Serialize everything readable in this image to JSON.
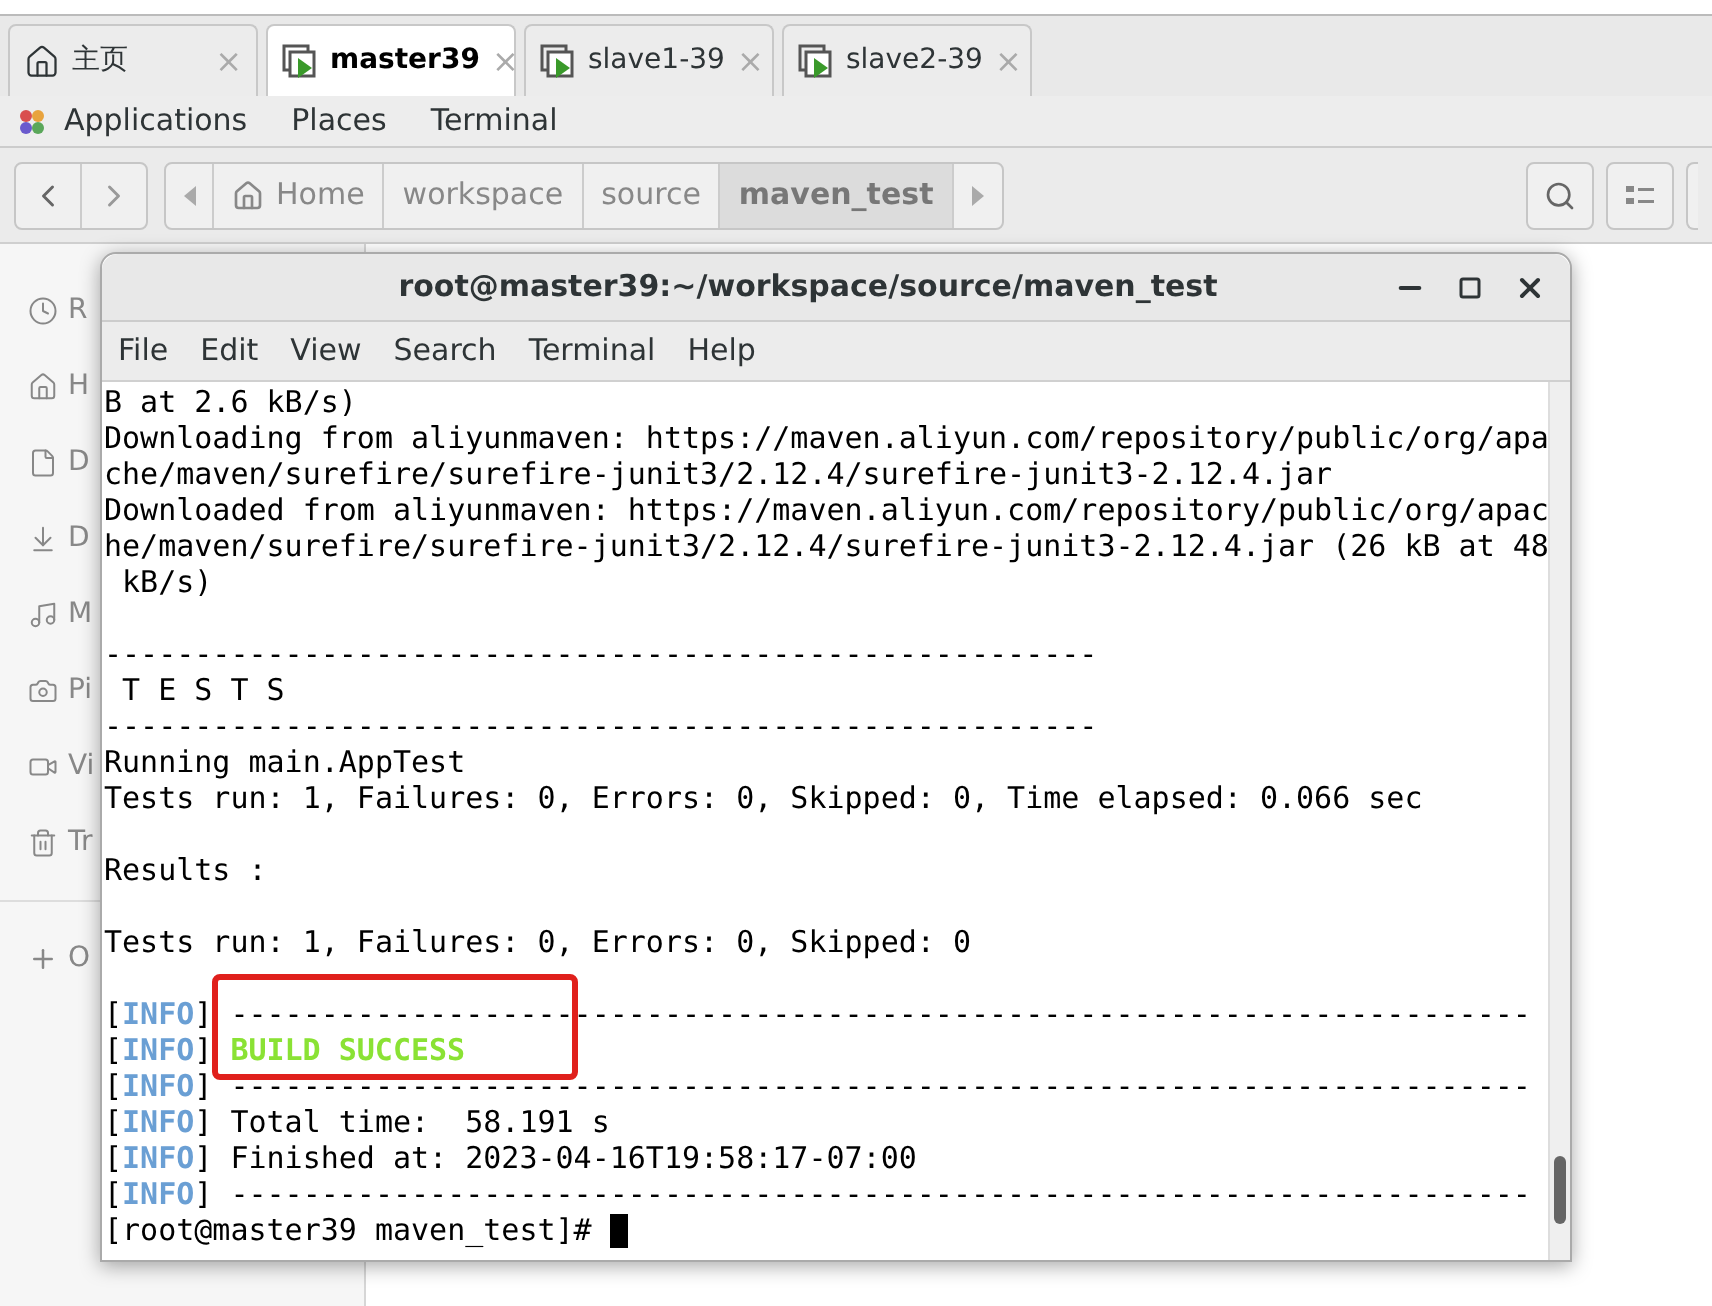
{
  "tabs": [
    {
      "label": "主页",
      "kind": "home",
      "close": "×",
      "selected": false
    },
    {
      "label": "master39",
      "kind": "session",
      "close": "×",
      "selected": true
    },
    {
      "label": "slave1-39",
      "kind": "session",
      "close": "×",
      "selected": false
    },
    {
      "label": "slave2-39",
      "kind": "session",
      "close": "×",
      "selected": false
    }
  ],
  "top_menu": [
    "Applications",
    "Places",
    "Terminal"
  ],
  "path_bar": [
    {
      "label": "Home",
      "kind": "home",
      "selected": false
    },
    {
      "label": "workspace",
      "kind": "folder",
      "selected": false
    },
    {
      "label": "source",
      "kind": "folder",
      "selected": false
    },
    {
      "label": "maven_test",
      "kind": "folder",
      "selected": true
    }
  ],
  "sidebar": {
    "items": [
      {
        "label": "R"
      },
      {
        "label": "H"
      },
      {
        "label": "D"
      },
      {
        "label": "D"
      },
      {
        "label": "M"
      },
      {
        "label": "Pi"
      },
      {
        "label": "Vi"
      },
      {
        "label": "Tr"
      }
    ],
    "other": {
      "label": "O"
    }
  },
  "terminal": {
    "title": "root@master39:~/workspace/source/maven_test",
    "menu": [
      "File",
      "Edit",
      "View",
      "Search",
      "Terminal",
      "Help"
    ],
    "lines": [
      {
        "kind": "plain",
        "text": "B at 2.6 kB/s)"
      },
      {
        "kind": "plain",
        "text": "Downloading from aliyunmaven: https://maven.aliyun.com/repository/public/org/apa"
      },
      {
        "kind": "plain",
        "text": "che/maven/surefire/surefire-junit3/2.12.4/surefire-junit3-2.12.4.jar"
      },
      {
        "kind": "plain",
        "text": "Downloaded from aliyunmaven: https://maven.aliyun.com/repository/public/org/apac"
      },
      {
        "kind": "plain",
        "text": "he/maven/surefire/surefire-junit3/2.12.4/surefire-junit3-2.12.4.jar (26 kB at 48"
      },
      {
        "kind": "plain",
        "text": " kB/s)"
      },
      {
        "kind": "blank"
      },
      {
        "kind": "plain",
        "text": "-------------------------------------------------------"
      },
      {
        "kind": "plain",
        "text": " T E S T S"
      },
      {
        "kind": "plain",
        "text": "-------------------------------------------------------"
      },
      {
        "kind": "plain",
        "text": "Running main.AppTest"
      },
      {
        "kind": "plain",
        "text": "Tests run: 1, Failures: 0, Errors: 0, Skipped: 0, Time elapsed: 0.066 sec"
      },
      {
        "kind": "blank"
      },
      {
        "kind": "plain",
        "text": "Results :"
      },
      {
        "kind": "blank"
      },
      {
        "kind": "plain",
        "text": "Tests run: 1, Failures: 0, Errors: 0, Skipped: 0"
      },
      {
        "kind": "blank"
      },
      {
        "kind": "info",
        "open": "[",
        "level": "INFO",
        "close": "]",
        "text": " ------------------------------------------------------------------------"
      },
      {
        "kind": "success",
        "open": "[",
        "level": "INFO",
        "close": "]",
        "text": "BUILD SUCCESS"
      },
      {
        "kind": "info",
        "open": "[",
        "level": "INFO",
        "close": "]",
        "text": " ------------------------------------------------------------------------"
      },
      {
        "kind": "info",
        "open": "[",
        "level": "INFO",
        "close": "]",
        "text": " Total time:  58.191 s"
      },
      {
        "kind": "info",
        "open": "[",
        "level": "INFO",
        "close": "]",
        "text": " Finished at: 2023-04-16T19:58:17-07:00"
      },
      {
        "kind": "info",
        "open": "[",
        "level": "INFO",
        "close": "]",
        "text": " ------------------------------------------------------------------------"
      },
      {
        "kind": "prompt",
        "text": "[root@master39 maven_test]# "
      }
    ]
  }
}
